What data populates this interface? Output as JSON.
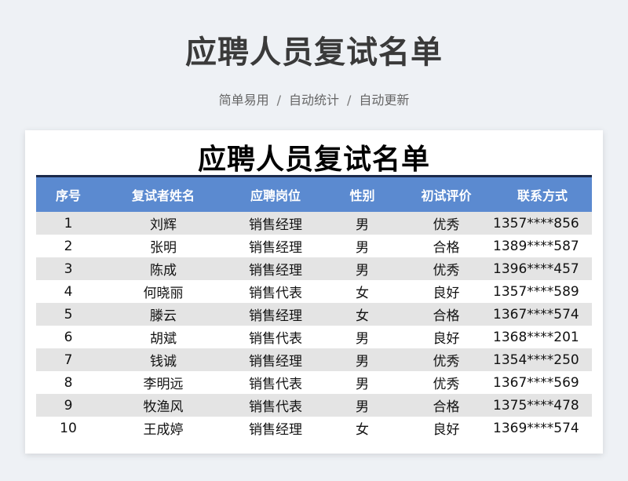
{
  "header": {
    "title": "应聘人员复试名单",
    "tags": [
      "简单易用",
      "自动统计",
      "自动更新"
    ],
    "separator": "/"
  },
  "sheet": {
    "title": "应聘人员复试名单",
    "columns": [
      "序号",
      "复试者姓名",
      "应聘岗位",
      "性别",
      "初试评价",
      "联系方式"
    ],
    "rows": [
      [
        "1",
        "刘辉",
        "销售经理",
        "男",
        "优秀",
        "1357****856"
      ],
      [
        "2",
        "张明",
        "销售经理",
        "男",
        "合格",
        "1389****587"
      ],
      [
        "3",
        "陈成",
        "销售经理",
        "男",
        "优秀",
        "1396****457"
      ],
      [
        "4",
        "何晓丽",
        "销售代表",
        "女",
        "良好",
        "1357****589"
      ],
      [
        "5",
        "滕云",
        "销售经理",
        "女",
        "合格",
        "1367****574"
      ],
      [
        "6",
        "胡斌",
        "销售代表",
        "男",
        "良好",
        "1368****201"
      ],
      [
        "7",
        "钱诚",
        "销售经理",
        "男",
        "优秀",
        "1354****250"
      ],
      [
        "8",
        "李明远",
        "销售代表",
        "男",
        "优秀",
        "1367****569"
      ],
      [
        "9",
        "牧渔风",
        "销售代表",
        "男",
        "合格",
        "1375****478"
      ],
      [
        "10",
        "王成婷",
        "销售经理",
        "女",
        "良好",
        "1369****574"
      ]
    ]
  },
  "colors": {
    "header_bg": "#5b8ad0",
    "stripe": "#e4e4e4",
    "rule": "#1b2a4a"
  }
}
